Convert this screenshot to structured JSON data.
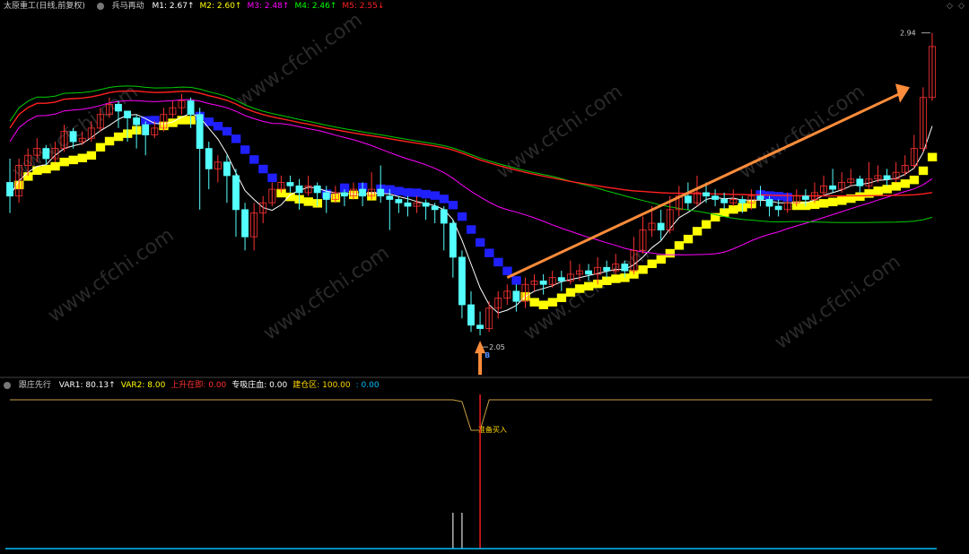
{
  "main_header": {
    "title": "太原重工(日线,前复权)",
    "indicator": "兵马再动",
    "items": [
      {
        "label": "M1: 2.67↑",
        "color": "#ffffff"
      },
      {
        "label": "M2: 2.60↑",
        "color": "#ffff00"
      },
      {
        "label": "M3: 2.48↑",
        "color": "#ff00ff"
      },
      {
        "label": "M4: 2.46↑",
        "color": "#00ff00"
      },
      {
        "label": "M5: 2.55↓",
        "color": "#ff2020"
      }
    ]
  },
  "sub_header": {
    "indicator": "跟庄先行",
    "items": [
      {
        "label": "VAR1: 80.13↑",
        "color": "#ffffff"
      },
      {
        "label": "VAR2: 8.00",
        "color": "#ffff00"
      },
      {
        "label": "上升在即: 0.00",
        "color": "#ff3030"
      },
      {
        "label": "专吸庄血: 0.00",
        "color": "#ffffff"
      },
      {
        "label": "建仓区: 100.00",
        "color": "#ffd700"
      },
      {
        "label": ": 0.00",
        "color": "#00bfff"
      }
    ]
  },
  "annotations": {
    "high_label": "2.94",
    "low_label": "2.05",
    "low_tag": "B",
    "buy_signal": "准备买入",
    "watermark": "www.cfchi.com"
  },
  "corner_icons": [
    "diamond-icon",
    "diamond-icon"
  ],
  "colors": {
    "up": "#ff3232",
    "down": "#54ffff",
    "m1": "#ffffff",
    "m3": "#ff00ff",
    "m4": "#00cc00",
    "m5": "#ff2020",
    "step_up": "#ffff00",
    "step_down": "#2020ff",
    "arrow": "#ff8c3a",
    "var_line": "#c8a040",
    "zero_line": "#00bfff"
  },
  "chart_data": {
    "type": "candlestick",
    "ylim": [
      1.95,
      3.0
    ],
    "candles": [
      [
        2.5,
        2.46,
        2.57,
        2.41
      ],
      [
        2.46,
        2.55,
        2.57,
        2.44
      ],
      [
        2.55,
        2.58,
        2.6,
        2.52
      ],
      [
        2.58,
        2.6,
        2.63,
        2.56
      ],
      [
        2.6,
        2.57,
        2.61,
        2.55
      ],
      [
        2.57,
        2.6,
        2.62,
        2.56
      ],
      [
        2.6,
        2.65,
        2.67,
        2.59
      ],
      [
        2.65,
        2.62,
        2.66,
        2.6
      ],
      [
        2.62,
        2.63,
        2.65,
        2.61
      ],
      [
        2.63,
        2.66,
        2.68,
        2.62
      ],
      [
        2.66,
        2.7,
        2.72,
        2.65
      ],
      [
        2.7,
        2.73,
        2.75,
        2.69
      ],
      [
        2.73,
        2.71,
        2.74,
        2.66
      ],
      [
        2.71,
        2.69,
        2.71,
        2.62
      ],
      [
        2.69,
        2.67,
        2.7,
        2.6
      ],
      [
        2.67,
        2.64,
        2.68,
        2.58
      ],
      [
        2.64,
        2.66,
        2.68,
        2.63
      ],
      [
        2.66,
        2.7,
        2.72,
        2.65
      ],
      [
        2.7,
        2.72,
        2.74,
        2.69
      ],
      [
        2.72,
        2.74,
        2.76,
        2.7
      ],
      [
        2.74,
        2.7,
        2.75,
        2.66
      ],
      [
        2.7,
        2.6,
        2.72,
        2.42
      ],
      [
        2.6,
        2.54,
        2.62,
        2.48
      ],
      [
        2.54,
        2.56,
        2.58,
        2.5
      ],
      [
        2.56,
        2.52,
        2.58,
        2.44
      ],
      [
        2.52,
        2.42,
        2.54,
        2.34
      ],
      [
        2.42,
        2.34,
        2.44,
        2.3
      ],
      [
        2.34,
        2.41,
        2.44,
        2.3
      ],
      [
        2.41,
        2.44,
        2.46,
        2.38
      ],
      [
        2.44,
        2.48,
        2.5,
        2.43
      ],
      [
        2.48,
        2.5,
        2.52,
        2.47
      ],
      [
        2.5,
        2.49,
        2.52,
        2.47
      ],
      [
        2.49,
        2.47,
        2.51,
        2.42
      ],
      [
        2.47,
        2.49,
        2.52,
        2.46
      ],
      [
        2.49,
        2.47,
        2.5,
        2.43
      ],
      [
        2.47,
        2.45,
        2.49,
        2.41
      ],
      [
        2.45,
        2.47,
        2.49,
        2.44
      ],
      [
        2.47,
        2.46,
        2.48,
        2.43
      ],
      [
        2.46,
        2.48,
        2.5,
        2.45
      ],
      [
        2.48,
        2.46,
        2.5,
        2.43
      ],
      [
        2.46,
        2.48,
        2.53,
        2.45
      ],
      [
        2.48,
        2.46,
        2.55,
        2.44
      ],
      [
        2.46,
        2.45,
        2.48,
        2.36
      ],
      [
        2.45,
        2.44,
        2.46,
        2.41
      ],
      [
        2.44,
        2.43,
        2.46,
        2.4
      ],
      [
        2.43,
        2.44,
        2.46,
        2.41
      ],
      [
        2.44,
        2.43,
        2.45,
        2.39
      ],
      [
        2.43,
        2.42,
        2.44,
        2.38
      ],
      [
        2.42,
        2.38,
        2.43,
        2.3
      ],
      [
        2.38,
        2.28,
        2.39,
        2.22
      ],
      [
        2.28,
        2.14,
        2.3,
        2.1
      ],
      [
        2.14,
        2.08,
        2.18,
        2.06
      ],
      [
        2.08,
        2.07,
        2.12,
        2.05
      ],
      [
        2.07,
        2.13,
        2.15,
        2.06
      ],
      [
        2.13,
        2.16,
        2.18,
        2.1
      ],
      [
        2.16,
        2.18,
        2.2,
        2.14
      ],
      [
        2.18,
        2.15,
        2.2,
        2.12
      ],
      [
        2.15,
        2.2,
        2.22,
        2.13
      ],
      [
        2.2,
        2.21,
        2.23,
        2.18
      ],
      [
        2.21,
        2.2,
        2.23,
        2.17
      ],
      [
        2.2,
        2.22,
        2.24,
        2.19
      ],
      [
        2.22,
        2.21,
        2.24,
        2.18
      ],
      [
        2.21,
        2.23,
        2.27,
        2.2
      ],
      [
        2.23,
        2.24,
        2.26,
        2.21
      ],
      [
        2.24,
        2.23,
        2.26,
        2.21
      ],
      [
        2.23,
        2.25,
        2.28,
        2.2
      ],
      [
        2.25,
        2.24,
        2.27,
        2.22
      ],
      [
        2.24,
        2.26,
        2.29,
        2.23
      ],
      [
        2.26,
        2.24,
        2.27,
        2.22
      ],
      [
        2.24,
        2.3,
        2.34,
        2.23
      ],
      [
        2.3,
        2.36,
        2.4,
        2.29
      ],
      [
        2.36,
        2.38,
        2.43,
        2.34
      ],
      [
        2.38,
        2.36,
        2.42,
        2.33
      ],
      [
        2.36,
        2.42,
        2.46,
        2.35
      ],
      [
        2.42,
        2.46,
        2.49,
        2.4
      ],
      [
        2.46,
        2.44,
        2.5,
        2.42
      ],
      [
        2.44,
        2.47,
        2.52,
        2.43
      ],
      [
        2.47,
        2.46,
        2.5,
        2.44
      ],
      [
        2.46,
        2.45,
        2.48,
        2.43
      ],
      [
        2.45,
        2.44,
        2.47,
        2.42
      ],
      [
        2.44,
        2.45,
        2.48,
        2.43
      ],
      [
        2.45,
        2.44,
        2.46,
        2.41
      ],
      [
        2.44,
        2.46,
        2.48,
        2.42
      ],
      [
        2.46,
        2.45,
        2.49,
        2.43
      ],
      [
        2.45,
        2.43,
        2.46,
        2.4
      ],
      [
        2.43,
        2.42,
        2.45,
        2.4
      ],
      [
        2.42,
        2.44,
        2.47,
        2.41
      ],
      [
        2.44,
        2.46,
        2.48,
        2.43
      ],
      [
        2.46,
        2.45,
        2.48,
        2.43
      ],
      [
        2.45,
        2.47,
        2.5,
        2.44
      ],
      [
        2.47,
        2.49,
        2.52,
        2.46
      ],
      [
        2.49,
        2.48,
        2.54,
        2.47
      ],
      [
        2.48,
        2.5,
        2.53,
        2.47
      ],
      [
        2.5,
        2.51,
        2.54,
        2.49
      ],
      [
        2.51,
        2.49,
        2.52,
        2.47
      ],
      [
        2.49,
        2.51,
        2.56,
        2.48
      ],
      [
        2.51,
        2.52,
        2.55,
        2.5
      ],
      [
        2.52,
        2.51,
        2.54,
        2.49
      ],
      [
        2.51,
        2.53,
        2.56,
        2.5
      ],
      [
        2.53,
        2.55,
        2.58,
        2.52
      ],
      [
        2.55,
        2.6,
        2.64,
        2.54
      ],
      [
        2.6,
        2.75,
        2.78,
        2.59
      ],
      [
        2.75,
        2.9,
        2.94,
        2.74
      ]
    ]
  }
}
